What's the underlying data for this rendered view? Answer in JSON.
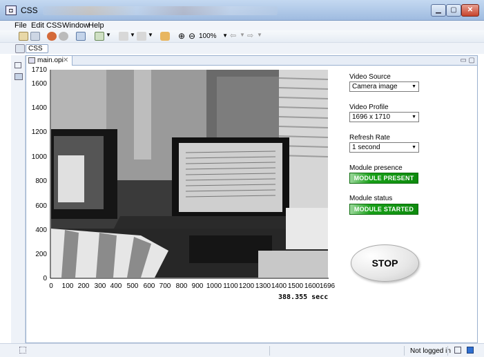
{
  "window": {
    "title": "CSS"
  },
  "menu": [
    {
      "label": "File"
    },
    {
      "label": "Edit"
    },
    {
      "label": "CSS"
    },
    {
      "label": "Window"
    },
    {
      "label": "Help"
    }
  ],
  "toolbar": {
    "zoom": "100%"
  },
  "perspective": {
    "label": "CSS"
  },
  "editor": {
    "tab_label": "main.opi"
  },
  "plot": {
    "y_ticks": [
      "1710",
      "1600",
      "1400",
      "1200",
      "1000",
      "800",
      "600",
      "400",
      "200",
      "0"
    ],
    "x_ticks": [
      "0",
      "100",
      "200",
      "300",
      "400",
      "500",
      "600",
      "700",
      "800",
      "900",
      "1000",
      "1100",
      "1200",
      "1300",
      "1400",
      "1500",
      "1600",
      "1696"
    ],
    "timer": "388.355 secc"
  },
  "controls": {
    "video_source": {
      "label": "Video Source",
      "value": "Camera image"
    },
    "video_profile": {
      "label": "Video Profile",
      "value": "1696 x 1710"
    },
    "refresh_rate": {
      "label": "Refresh Rate",
      "value": "1 second"
    },
    "module_presence": {
      "label": "Module presence",
      "value": "MODULE PRESENT",
      "color": "#12a012"
    },
    "module_status": {
      "label": "Module status",
      "value": "MODULE STARTED",
      "color": "#12a012"
    },
    "stop_button": {
      "label": "STOP"
    }
  },
  "status": {
    "login": "Not logged in"
  }
}
